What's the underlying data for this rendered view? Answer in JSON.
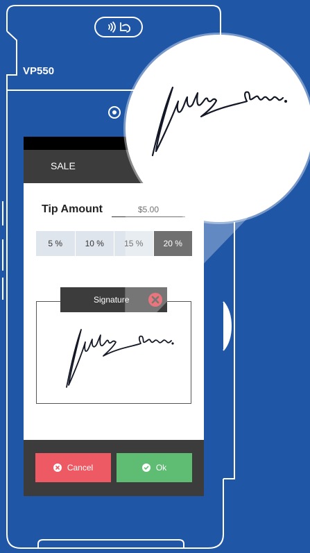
{
  "device": {
    "model": "VP550"
  },
  "screen": {
    "title": "SALE",
    "tip": {
      "label": "Tip Amount",
      "amount": "$5.00"
    },
    "tip_options": [
      {
        "label": "5 %",
        "selected": false
      },
      {
        "label": "10 %",
        "selected": false
      },
      {
        "label": "15 %",
        "selected": false
      },
      {
        "label": "20 %",
        "selected": true
      }
    ],
    "signature": {
      "label": "Signature"
    },
    "buttons": {
      "cancel": "Cancel",
      "ok": "Ok"
    }
  },
  "icons": {
    "contactless": "contactless-payment-icon",
    "close": "close-icon",
    "cancel": "cancel-x-icon",
    "ok": "check-icon"
  },
  "colors": {
    "background": "#1f56a6",
    "header": "#3c3c3c",
    "tip_option": "#dfe5ec",
    "tip_selected": "#333333",
    "cancel": "#ee5a64",
    "ok": "#5fbd73",
    "close": "#e23a45"
  }
}
